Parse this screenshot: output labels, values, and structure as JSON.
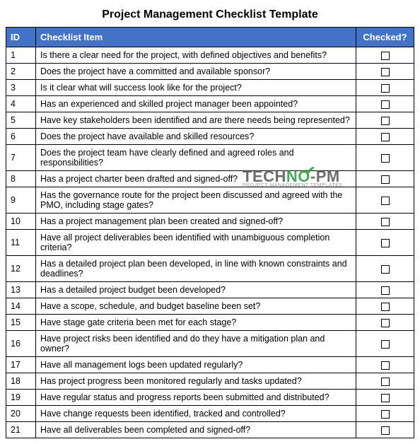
{
  "title": "Project Management Checklist Template",
  "columns": {
    "id": "ID",
    "item": "Checklist Item",
    "checked": "Checked?"
  },
  "rows": [
    {
      "id": "1",
      "item": "Is there a clear need for the project, with defined objectives and benefits?"
    },
    {
      "id": "2",
      "item": "Does the project have a committed and available sponsor?"
    },
    {
      "id": "3",
      "item": "Is it clear what will success look like for the project?"
    },
    {
      "id": "4",
      "item": "Has an experienced and skilled project manager been appointed?"
    },
    {
      "id": "5",
      "item": "Have key stakeholders been identified and are there needs being represented?"
    },
    {
      "id": "6",
      "item": "Does the project have available and skilled resources?"
    },
    {
      "id": "7",
      "item": "Does the project team have clearly defined and agreed roles and responsibilities?"
    },
    {
      "id": "8",
      "item": "Has a project charter been drafted and signed-off?"
    },
    {
      "id": "9",
      "item": "Has the governance route for the project been discussed and agreed with the PMO, including stage gates?"
    },
    {
      "id": "10",
      "item": "Has a project management plan been created and signed-off?"
    },
    {
      "id": "11",
      "item": "Have all project deliverables been identified with unambiguous completion criteria?"
    },
    {
      "id": "12",
      "item": "Has a detailed project plan been developed, in line with known constraints and deadlines?"
    },
    {
      "id": "13",
      "item": "Has a detailed project budget been developed?"
    },
    {
      "id": "14",
      "item": "Have a scope, schedule, and budget baseline been set?"
    },
    {
      "id": "15",
      "item": "Have stage gate criteria been met for each stage?"
    },
    {
      "id": "16",
      "item": "Have project risks been identified and do they have a mitigation plan and owner?"
    },
    {
      "id": "17",
      "item": "Have all management logs been updated regularly?"
    },
    {
      "id": "18",
      "item": "Has project progress been monitored regularly and tasks updated?"
    },
    {
      "id": "19",
      "item": "Have regular status and progress reports been submitted and distributed?"
    },
    {
      "id": "20",
      "item": "Have change requests been identified, tracked and controlled?"
    },
    {
      "id": "21",
      "item": "Have all deliverables been completed and signed-off?"
    }
  ],
  "watermark": {
    "brand_pre": "TECH",
    "brand_n": "N",
    "brand_o": "O",
    "brand_suffix": "-PM",
    "tagline": "PROJECT MANAGEMENT TEMPLATES"
  }
}
